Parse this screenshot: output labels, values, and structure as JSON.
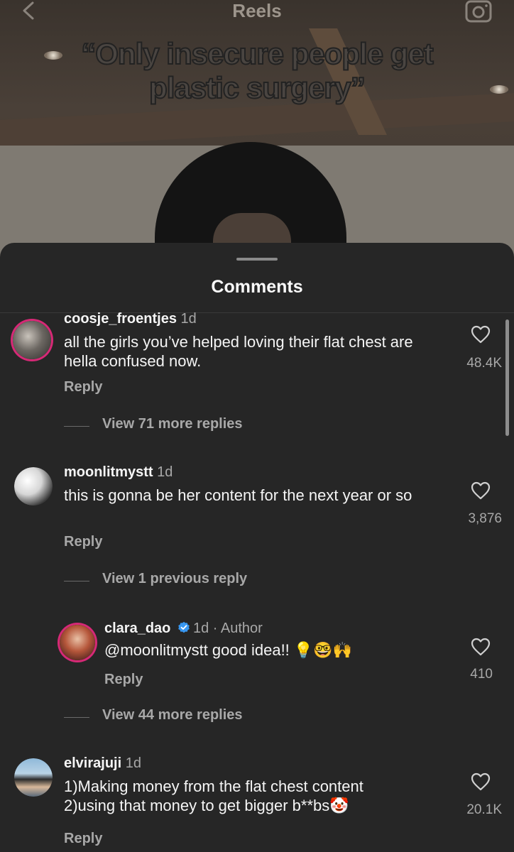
{
  "header": {
    "title": "Reels",
    "back_icon": "chevron-left-icon",
    "camera_icon": "camera-icon"
  },
  "video": {
    "caption": "“Only insecure people get plastic surgery”"
  },
  "sheet": {
    "title": "Comments"
  },
  "comments": [
    {
      "username": "coosje_froentjes",
      "time": "1d",
      "text": "all the girls you’ve helped loving their flat chest are hella confused now.",
      "likes": "48.4K",
      "reply_label": "Reply",
      "view_more": "View 71 more replies"
    },
    {
      "username": "moonlitmystt",
      "time": "1d",
      "text": "this is gonna be her content for the next year or so",
      "likes": "3,876",
      "reply_label": "Reply",
      "view_more": "View 1 previous reply"
    },
    {
      "username": "clara_dao",
      "time": "1d",
      "author_tag": "Author",
      "verified": true,
      "text": "@moonlitmystt good idea!! 💡🤓🙌",
      "likes": "410",
      "reply_label": "Reply",
      "view_more": "View 44 more replies"
    },
    {
      "username": "elvirajuji",
      "time": "1d",
      "text": "1)Making money from the flat chest content 2)using that money to get bigger b**bs🤡",
      "likes": "20.1K",
      "reply_label": "Reply"
    }
  ],
  "colors": {
    "background": "#262626",
    "story_ring": "#d62976",
    "verified": "#3897f0",
    "muted_text": "#a8a8a8"
  }
}
